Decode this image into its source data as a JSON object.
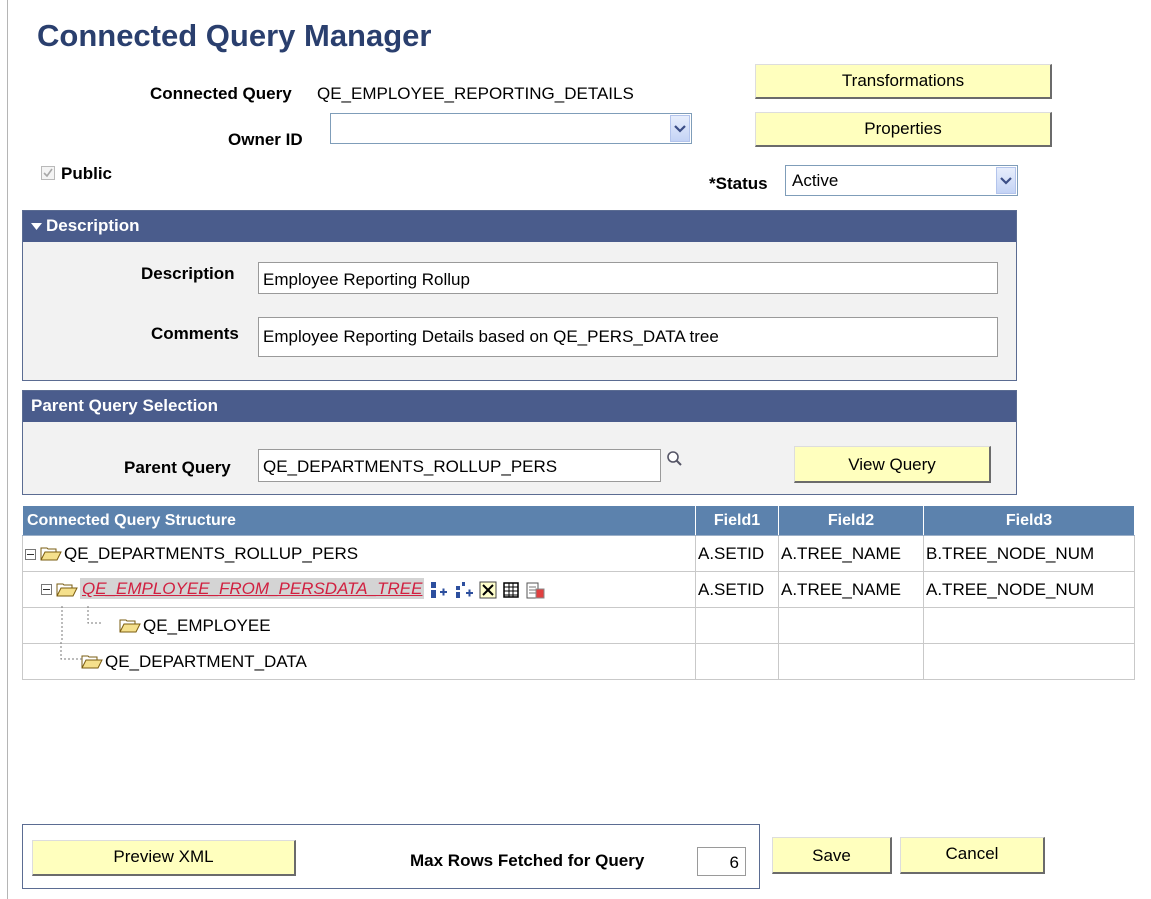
{
  "page": {
    "title": "Connected Query Manager"
  },
  "header": {
    "connected_query_label": "Connected Query",
    "connected_query_value": "QE_EMPLOYEE_REPORTING_DETAILS",
    "owner_id_label": "Owner ID",
    "owner_id_value": "",
    "public_label": "Public",
    "public_checked": true,
    "status_label": "*Status",
    "status_value": "Active",
    "transformations_button": "Transformations",
    "properties_button": "Properties"
  },
  "description_section": {
    "title": "Description",
    "description_label": "Description",
    "description_value": "Employee Reporting Rollup",
    "comments_label": "Comments",
    "comments_value": "Employee Reporting Details based on QE_PERS_DATA tree"
  },
  "parent_section": {
    "title": "Parent Query Selection",
    "parent_query_label": "Parent Query",
    "parent_query_value": "QE_DEPARTMENTS_ROLLUP_PERS",
    "view_query_button": "View Query"
  },
  "structure": {
    "columns": [
      "Connected Query Structure",
      "Field1",
      "Field2",
      "Field3"
    ],
    "rows": [
      {
        "name": "QE_DEPARTMENTS_ROLLUP_PERS",
        "field1": "A.SETID",
        "field2": "A.TREE_NAME",
        "field3": "B.TREE_NODE_NUM"
      },
      {
        "name": "QE_EMPLOYEE_FROM_PERSDATA_TREE",
        "field1": "A.SETID",
        "field2": "A.TREE_NAME",
        "field3": "A.TREE_NODE_NUM"
      },
      {
        "name": "QE_EMPLOYEE",
        "field1": "",
        "field2": "",
        "field3": ""
      },
      {
        "name": "QE_DEPARTMENT_DATA",
        "field1": "",
        "field2": "",
        "field3": ""
      }
    ]
  },
  "footer": {
    "preview_xml_button": "Preview XML",
    "max_rows_label": "Max Rows Fetched for Query",
    "max_rows_value": "6",
    "save_button": "Save",
    "cancel_button": "Cancel"
  }
}
